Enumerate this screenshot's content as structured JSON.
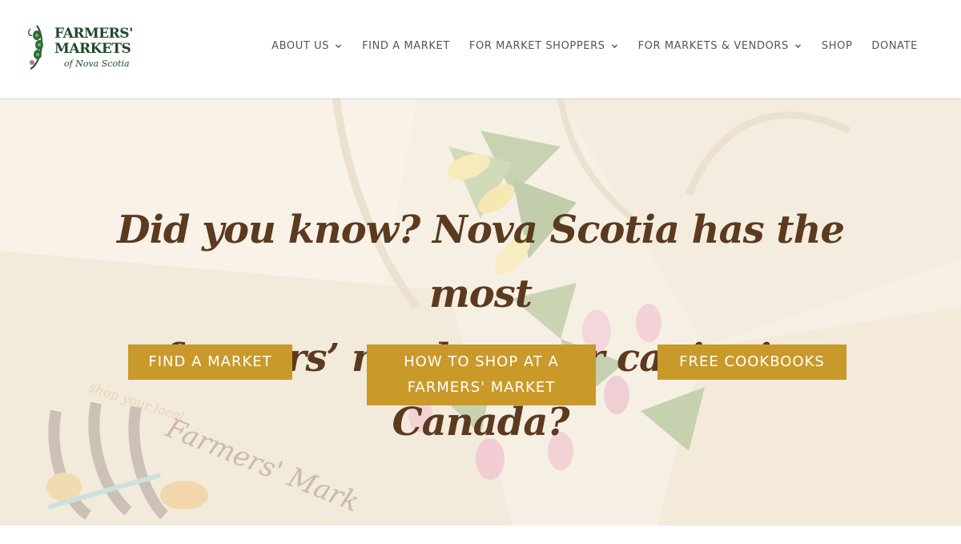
{
  "logo": {
    "line1": "FARMERS'",
    "line2": "MARKETS",
    "line3": "of Nova Scotia",
    "icon": "peapod-icon",
    "color": "#1f4a2a"
  },
  "nav": {
    "items": [
      {
        "label": "ABOUT US",
        "has_dropdown": true
      },
      {
        "label": "FIND A MARKET",
        "has_dropdown": false
      },
      {
        "label": "FOR MARKET SHOPPERS",
        "has_dropdown": true
      },
      {
        "label": "FOR MARKETS & VENDORS",
        "has_dropdown": true
      },
      {
        "label": "SHOP",
        "has_dropdown": false
      },
      {
        "label": "DONATE",
        "has_dropdown": false
      }
    ],
    "dropdown_icon": "chevron-down-icon"
  },
  "hero": {
    "headline_line1": "Did you know? Nova Scotia has the most",
    "headline_line2": "farmers’ markets per capita in Canada?",
    "buttons": {
      "find": "FIND A MARKET",
      "how_line1": "HOW TO SHOP AT A",
      "how_line2": "FARMERS' MARKET",
      "cookbooks": "FREE COOKBOOKS"
    },
    "bag_print_line1": "shop your local",
    "bag_print_line2": "Farmers' Mark"
  },
  "colors": {
    "accent": "#c9992a",
    "headline": "#5c3a1e",
    "nav_text": "#555555"
  }
}
